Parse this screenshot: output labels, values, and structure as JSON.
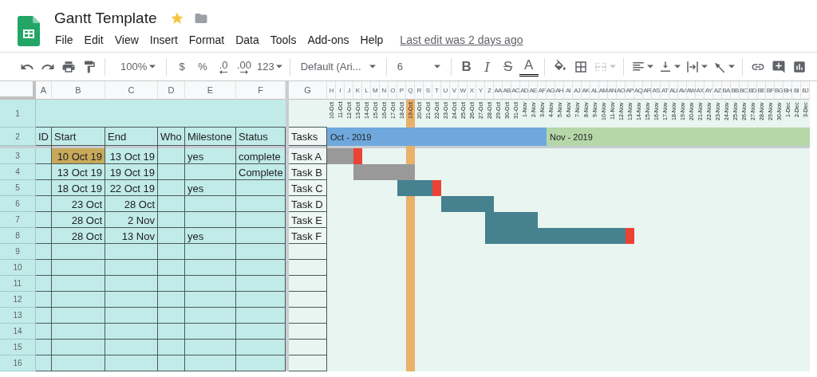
{
  "app": {
    "title": "Gantt Template",
    "menu": [
      "File",
      "Edit",
      "View",
      "Insert",
      "Format",
      "Data",
      "Tools",
      "Add-ons",
      "Help"
    ],
    "last_edit": "Last edit was 2 days ago"
  },
  "toolbar": {
    "groups": [
      {
        "items": [
          {
            "kind": "undo",
            "disabled": false
          },
          {
            "kind": "redo",
            "disabled": false
          },
          {
            "kind": "print",
            "disabled": false
          },
          {
            "kind": "paint",
            "disabled": false
          }
        ]
      },
      {
        "items": [
          {
            "kind": "zoom-select",
            "label": "100%",
            "disabled": false
          }
        ]
      },
      {
        "items": [
          {
            "kind": "text",
            "label": "$",
            "disabled": false
          },
          {
            "kind": "text",
            "label": "%",
            "disabled": false
          },
          {
            "kind": "decimal-less",
            "label": ".0",
            "disabled": false
          },
          {
            "kind": "decimal-more",
            "label": ".00",
            "disabled": false
          },
          {
            "kind": "format-menu",
            "label": "123",
            "disabled": false
          }
        ]
      },
      {
        "items": [
          {
            "kind": "font-select",
            "label": "Default (Ari...",
            "disabled": false
          }
        ]
      },
      {
        "items": [
          {
            "kind": "size-select",
            "label": "6",
            "disabled": false
          }
        ]
      },
      {
        "items": [
          {
            "kind": "bold",
            "label": "B",
            "disabled": false
          },
          {
            "kind": "italic",
            "label": "I",
            "disabled": false
          },
          {
            "kind": "strike",
            "label": "S",
            "disabled": false
          },
          {
            "kind": "text-color",
            "label": "A",
            "disabled": false
          }
        ]
      },
      {
        "items": [
          {
            "kind": "fill",
            "disabled": false
          },
          {
            "kind": "borders",
            "disabled": false
          },
          {
            "kind": "merge",
            "disabled": true
          }
        ]
      },
      {
        "items": [
          {
            "kind": "align",
            "disabled": false
          },
          {
            "kind": "valign",
            "disabled": false
          },
          {
            "kind": "wrap",
            "disabled": false
          },
          {
            "kind": "rotate",
            "disabled": false
          }
        ]
      },
      {
        "items": [
          {
            "kind": "link",
            "disabled": false
          },
          {
            "kind": "comment",
            "disabled": false
          },
          {
            "kind": "chart",
            "disabled": false
          }
        ]
      }
    ]
  },
  "sheet": {
    "columns": [
      "A",
      "B",
      "C",
      "D",
      "E",
      "F"
    ],
    "task_column": "G",
    "row_numbers": [
      "1",
      "2",
      "3",
      "4",
      "5",
      "6",
      "7",
      "8",
      "9",
      "10",
      "11",
      "12",
      "13",
      "14",
      "15",
      "16"
    ],
    "headers": [
      "ID",
      "Start",
      "End",
      "Who",
      "Milestone",
      "Status"
    ],
    "task_header": "Tasks",
    "rows": [
      {
        "start": "10 Oct 19",
        "start_highlighted": true,
        "end": "13 Oct 19",
        "milestone": "yes",
        "status": "complete",
        "task": "Task A",
        "cells": [
          {
            "kind": "done"
          },
          {
            "kind": "done"
          },
          {
            "kind": "done"
          },
          {
            "kind": "milestone"
          },
          {
            "kind": "none"
          },
          {
            "kind": "none"
          },
          {
            "kind": "none"
          },
          {
            "kind": "none"
          },
          {
            "kind": "none"
          },
          {
            "kind": "none"
          },
          {
            "kind": "none"
          },
          {
            "kind": "none"
          },
          {
            "kind": "none"
          },
          {
            "kind": "none"
          },
          {
            "kind": "none"
          },
          {
            "kind": "none"
          },
          {
            "kind": "none"
          },
          {
            "kind": "none"
          },
          {
            "kind": "none"
          },
          {
            "kind": "none"
          },
          {
            "kind": "none"
          },
          {
            "kind": "none"
          },
          {
            "kind": "none"
          },
          {
            "kind": "none"
          },
          {
            "kind": "none"
          },
          {
            "kind": "none"
          },
          {
            "kind": "none"
          },
          {
            "kind": "none"
          },
          {
            "kind": "none"
          },
          {
            "kind": "none"
          },
          {
            "kind": "none"
          },
          {
            "kind": "none"
          },
          {
            "kind": "none"
          },
          {
            "kind": "none"
          },
          {
            "kind": "none"
          },
          {
            "kind": "none"
          },
          {
            "kind": "none"
          },
          {
            "kind": "none"
          },
          {
            "kind": "none"
          },
          {
            "kind": "none"
          },
          {
            "kind": "none"
          },
          {
            "kind": "none"
          },
          {
            "kind": "none"
          },
          {
            "kind": "none"
          },
          {
            "kind": "none"
          },
          {
            "kind": "none"
          },
          {
            "kind": "none"
          },
          {
            "kind": "none"
          },
          {
            "kind": "none"
          },
          {
            "kind": "none"
          },
          {
            "kind": "none"
          },
          {
            "kind": "none"
          },
          {
            "kind": "none"
          },
          {
            "kind": "none"
          },
          {
            "kind": "none"
          }
        ]
      },
      {
        "start": "13 Oct 19",
        "start_highlighted": false,
        "end": "19 Oct 19",
        "status": "Complete",
        "task": "Task B",
        "cells": [
          {
            "kind": "none"
          },
          {
            "kind": "none"
          },
          {
            "kind": "none"
          },
          {
            "kind": "done"
          },
          {
            "kind": "done"
          },
          {
            "kind": "done"
          },
          {
            "kind": "done"
          },
          {
            "kind": "done"
          },
          {
            "kind": "done"
          },
          {
            "kind": "done"
          },
          {
            "kind": "none"
          },
          {
            "kind": "none"
          },
          {
            "kind": "none"
          },
          {
            "kind": "none"
          },
          {
            "kind": "none"
          },
          {
            "kind": "none"
          },
          {
            "kind": "none"
          },
          {
            "kind": "none"
          },
          {
            "kind": "none"
          },
          {
            "kind": "none"
          },
          {
            "kind": "none"
          },
          {
            "kind": "none"
          },
          {
            "kind": "none"
          },
          {
            "kind": "none"
          },
          {
            "kind": "none"
          },
          {
            "kind": "none"
          },
          {
            "kind": "none"
          },
          {
            "kind": "none"
          },
          {
            "kind": "none"
          },
          {
            "kind": "none"
          },
          {
            "kind": "none"
          },
          {
            "kind": "none"
          },
          {
            "kind": "none"
          },
          {
            "kind": "none"
          },
          {
            "kind": "none"
          },
          {
            "kind": "none"
          },
          {
            "kind": "none"
          },
          {
            "kind": "none"
          },
          {
            "kind": "none"
          },
          {
            "kind": "none"
          },
          {
            "kind": "none"
          },
          {
            "kind": "none"
          },
          {
            "kind": "none"
          },
          {
            "kind": "none"
          },
          {
            "kind": "none"
          },
          {
            "kind": "none"
          },
          {
            "kind": "none"
          },
          {
            "kind": "none"
          },
          {
            "kind": "none"
          },
          {
            "kind": "none"
          },
          {
            "kind": "none"
          },
          {
            "kind": "none"
          },
          {
            "kind": "none"
          },
          {
            "kind": "none"
          },
          {
            "kind": "none"
          }
        ]
      },
      {
        "start": "18 Oct 19",
        "start_highlighted": false,
        "end": "22 Oct 19",
        "milestone": "yes",
        "task": "Task C",
        "cells": [
          {
            "kind": "none"
          },
          {
            "kind": "none"
          },
          {
            "kind": "none"
          },
          {
            "kind": "none"
          },
          {
            "kind": "none"
          },
          {
            "kind": "none"
          },
          {
            "kind": "none"
          },
          {
            "kind": "none"
          },
          {
            "kind": "active"
          },
          {
            "kind": "active"
          },
          {
            "kind": "active"
          },
          {
            "kind": "active"
          },
          {
            "kind": "milestone"
          },
          {
            "kind": "none"
          },
          {
            "kind": "none"
          },
          {
            "kind": "none"
          },
          {
            "kind": "none"
          },
          {
            "kind": "none"
          },
          {
            "kind": "none"
          },
          {
            "kind": "none"
          },
          {
            "kind": "none"
          },
          {
            "kind": "none"
          },
          {
            "kind": "none"
          },
          {
            "kind": "none"
          },
          {
            "kind": "none"
          },
          {
            "kind": "none"
          },
          {
            "kind": "none"
          },
          {
            "kind": "none"
          },
          {
            "kind": "none"
          },
          {
            "kind": "none"
          },
          {
            "kind": "none"
          },
          {
            "kind": "none"
          },
          {
            "kind": "none"
          },
          {
            "kind": "none"
          },
          {
            "kind": "none"
          },
          {
            "kind": "none"
          },
          {
            "kind": "none"
          },
          {
            "kind": "none"
          },
          {
            "kind": "none"
          },
          {
            "kind": "none"
          },
          {
            "kind": "none"
          },
          {
            "kind": "none"
          },
          {
            "kind": "none"
          },
          {
            "kind": "none"
          },
          {
            "kind": "none"
          },
          {
            "kind": "none"
          },
          {
            "kind": "none"
          },
          {
            "kind": "none"
          },
          {
            "kind": "none"
          },
          {
            "kind": "none"
          },
          {
            "kind": "none"
          },
          {
            "kind": "none"
          },
          {
            "kind": "none"
          },
          {
            "kind": "none"
          },
          {
            "kind": "none"
          }
        ]
      },
      {
        "start": "23 Oct",
        "start_highlighted": false,
        "end": "28 Oct",
        "task": "Task D",
        "cells": [
          {
            "kind": "none"
          },
          {
            "kind": "none"
          },
          {
            "kind": "none"
          },
          {
            "kind": "none"
          },
          {
            "kind": "none"
          },
          {
            "kind": "none"
          },
          {
            "kind": "none"
          },
          {
            "kind": "none"
          },
          {
            "kind": "none"
          },
          {
            "kind": "none"
          },
          {
            "kind": "none"
          },
          {
            "kind": "none"
          },
          {
            "kind": "none"
          },
          {
            "kind": "active"
          },
          {
            "kind": "active"
          },
          {
            "kind": "active"
          },
          {
            "kind": "active"
          },
          {
            "kind": "active"
          },
          {
            "kind": "active"
          },
          {
            "kind": "none"
          },
          {
            "kind": "none"
          },
          {
            "kind": "none"
          },
          {
            "kind": "none"
          },
          {
            "kind": "none"
          },
          {
            "kind": "none"
          },
          {
            "kind": "none"
          },
          {
            "kind": "none"
          },
          {
            "kind": "none"
          },
          {
            "kind": "none"
          },
          {
            "kind": "none"
          },
          {
            "kind": "none"
          },
          {
            "kind": "none"
          },
          {
            "kind": "none"
          },
          {
            "kind": "none"
          },
          {
            "kind": "none"
          },
          {
            "kind": "none"
          },
          {
            "kind": "none"
          },
          {
            "kind": "none"
          },
          {
            "kind": "none"
          },
          {
            "kind": "none"
          },
          {
            "kind": "none"
          },
          {
            "kind": "none"
          },
          {
            "kind": "none"
          },
          {
            "kind": "none"
          },
          {
            "kind": "none"
          },
          {
            "kind": "none"
          },
          {
            "kind": "none"
          },
          {
            "kind": "none"
          },
          {
            "kind": "none"
          },
          {
            "kind": "none"
          },
          {
            "kind": "none"
          },
          {
            "kind": "none"
          },
          {
            "kind": "none"
          },
          {
            "kind": "none"
          },
          {
            "kind": "none"
          }
        ]
      },
      {
        "start": "28 Oct",
        "start_highlighted": false,
        "end": "2 Nov",
        "task": "Task E",
        "cells": [
          {
            "kind": "none"
          },
          {
            "kind": "none"
          },
          {
            "kind": "none"
          },
          {
            "kind": "none"
          },
          {
            "kind": "none"
          },
          {
            "kind": "none"
          },
          {
            "kind": "none"
          },
          {
            "kind": "none"
          },
          {
            "kind": "none"
          },
          {
            "kind": "none"
          },
          {
            "kind": "none"
          },
          {
            "kind": "none"
          },
          {
            "kind": "none"
          },
          {
            "kind": "none"
          },
          {
            "kind": "none"
          },
          {
            "kind": "none"
          },
          {
            "kind": "none"
          },
          {
            "kind": "none"
          },
          {
            "kind": "active"
          },
          {
            "kind": "active"
          },
          {
            "kind": "active"
          },
          {
            "kind": "active"
          },
          {
            "kind": "active"
          },
          {
            "kind": "active"
          },
          {
            "kind": "none"
          },
          {
            "kind": "none"
          },
          {
            "kind": "none"
          },
          {
            "kind": "none"
          },
          {
            "kind": "none"
          },
          {
            "kind": "none"
          },
          {
            "kind": "none"
          },
          {
            "kind": "none"
          },
          {
            "kind": "none"
          },
          {
            "kind": "none"
          },
          {
            "kind": "none"
          },
          {
            "kind": "none"
          },
          {
            "kind": "none"
          },
          {
            "kind": "none"
          },
          {
            "kind": "none"
          },
          {
            "kind": "none"
          },
          {
            "kind": "none"
          },
          {
            "kind": "none"
          },
          {
            "kind": "none"
          },
          {
            "kind": "none"
          },
          {
            "kind": "none"
          },
          {
            "kind": "none"
          },
          {
            "kind": "none"
          },
          {
            "kind": "none"
          },
          {
            "kind": "none"
          },
          {
            "kind": "none"
          },
          {
            "kind": "none"
          },
          {
            "kind": "none"
          },
          {
            "kind": "none"
          },
          {
            "kind": "none"
          },
          {
            "kind": "none"
          }
        ]
      },
      {
        "start": "28 Oct",
        "start_highlighted": false,
        "end": "13 Nov",
        "milestone": "yes",
        "task": "Task F",
        "cells": [
          {
            "kind": "none"
          },
          {
            "kind": "none"
          },
          {
            "kind": "none"
          },
          {
            "kind": "none"
          },
          {
            "kind": "none"
          },
          {
            "kind": "none"
          },
          {
            "kind": "none"
          },
          {
            "kind": "none"
          },
          {
            "kind": "none"
          },
          {
            "kind": "none"
          },
          {
            "kind": "none"
          },
          {
            "kind": "none"
          },
          {
            "kind": "none"
          },
          {
            "kind": "none"
          },
          {
            "kind": "none"
          },
          {
            "kind": "none"
          },
          {
            "kind": "none"
          },
          {
            "kind": "none"
          },
          {
            "kind": "active"
          },
          {
            "kind": "active"
          },
          {
            "kind": "active"
          },
          {
            "kind": "active"
          },
          {
            "kind": "active"
          },
          {
            "kind": "active"
          },
          {
            "kind": "active"
          },
          {
            "kind": "active"
          },
          {
            "kind": "active"
          },
          {
            "kind": "active"
          },
          {
            "kind": "active"
          },
          {
            "kind": "active"
          },
          {
            "kind": "active"
          },
          {
            "kind": "active"
          },
          {
            "kind": "active"
          },
          {
            "kind": "active"
          },
          {
            "kind": "milestone"
          },
          {
            "kind": "none"
          },
          {
            "kind": "none"
          },
          {
            "kind": "none"
          },
          {
            "kind": "none"
          },
          {
            "kind": "none"
          },
          {
            "kind": "none"
          },
          {
            "kind": "none"
          },
          {
            "kind": "none"
          },
          {
            "kind": "none"
          },
          {
            "kind": "none"
          },
          {
            "kind": "none"
          },
          {
            "kind": "none"
          },
          {
            "kind": "none"
          },
          {
            "kind": "none"
          },
          {
            "kind": "none"
          },
          {
            "kind": "none"
          },
          {
            "kind": "none"
          },
          {
            "kind": "none"
          },
          {
            "kind": "none"
          },
          {
            "kind": "none"
          }
        ]
      }
    ]
  },
  "timeline": {
    "months": [
      {
        "label": "Oct - 2019",
        "color": "#6fa8dc",
        "days": [
          {
            "col": "H",
            "date": "10-Oct",
            "today": false
          },
          {
            "col": "I",
            "date": "11-Oct",
            "today": false
          },
          {
            "col": "J",
            "date": "12-Oct",
            "today": false
          },
          {
            "col": "K",
            "date": "13-Oct",
            "today": false
          },
          {
            "col": "L",
            "date": "14-Oct",
            "today": false
          },
          {
            "col": "M",
            "date": "15-Oct",
            "today": false
          },
          {
            "col": "N",
            "date": "16-Oct",
            "today": false
          },
          {
            "col": "O",
            "date": "17-Oct",
            "today": false
          },
          {
            "col": "P",
            "date": "18-Oct",
            "today": false
          },
          {
            "col": "Q",
            "date": "19-Oct",
            "today": true
          },
          {
            "col": "R",
            "date": "20-Oct",
            "today": false
          },
          {
            "col": "S",
            "date": "21-Oct",
            "today": false
          },
          {
            "col": "T",
            "date": "22-Oct",
            "today": false
          },
          {
            "col": "U",
            "date": "23-Oct",
            "today": false
          },
          {
            "col": "V",
            "date": "24-Oct",
            "today": false
          },
          {
            "col": "W",
            "date": "25-Oct",
            "today": false
          },
          {
            "col": "X",
            "date": "26-Oct",
            "today": false
          },
          {
            "col": "Y",
            "date": "27-Oct",
            "today": false
          },
          {
            "col": "Z",
            "date": "28-Oct",
            "today": false
          },
          {
            "col": "AA",
            "date": "29-Oct",
            "today": false
          },
          {
            "col": "AB",
            "date": "30-Oct",
            "today": false
          },
          {
            "col": "AC",
            "date": "31-Oct",
            "today": false
          },
          {
            "col": "AD",
            "date": "1-Nov",
            "today": false
          },
          {
            "col": "AE",
            "date": "2-Nov",
            "today": false
          },
          {
            "col": "AF",
            "date": "3-Nov",
            "today": false
          }
        ]
      },
      {
        "label": "Nov - 2019",
        "color": "#b6d7a8",
        "days": [
          {
            "col": "AG",
            "date": "4-Nov",
            "today": false
          },
          {
            "col": "AH",
            "date": "5-Nov",
            "today": false
          },
          {
            "col": "AI",
            "date": "6-Nov",
            "today": false
          },
          {
            "col": "AJ",
            "date": "7-Nov",
            "today": false
          },
          {
            "col": "AK",
            "date": "8-Nov",
            "today": false
          },
          {
            "col": "AL",
            "date": "9-Nov",
            "today": false
          },
          {
            "col": "AM",
            "date": "10-Nov",
            "today": false
          },
          {
            "col": "AN",
            "date": "11-Nov",
            "today": false
          },
          {
            "col": "AO",
            "date": "12-Nov",
            "today": false
          },
          {
            "col": "AP",
            "date": "13-Nov",
            "today": false
          },
          {
            "col": "AQ",
            "date": "14-Nov",
            "today": false
          },
          {
            "col": "AR",
            "date": "15-Nov",
            "today": false
          },
          {
            "col": "AS",
            "date": "16-Nov",
            "today": false
          },
          {
            "col": "AT",
            "date": "17-Nov",
            "today": false
          },
          {
            "col": "AU",
            "date": "18-Nov",
            "today": false
          },
          {
            "col": "AV",
            "date": "19-Nov",
            "today": false
          },
          {
            "col": "AW",
            "date": "20-Nov",
            "today": false
          },
          {
            "col": "AX",
            "date": "21-Nov",
            "today": false
          },
          {
            "col": "AY",
            "date": "22-Nov",
            "today": false
          },
          {
            "col": "AZ",
            "date": "23-Nov",
            "today": false
          },
          {
            "col": "BA",
            "date": "24-Nov",
            "today": false
          },
          {
            "col": "BB",
            "date": "25-Nov",
            "today": false
          },
          {
            "col": "BC",
            "date": "26-Nov",
            "today": false
          },
          {
            "col": "BD",
            "date": "27-Nov",
            "today": false
          },
          {
            "col": "BE",
            "date": "28-Nov",
            "today": false
          },
          {
            "col": "BF",
            "date": "29-Nov",
            "today": false
          },
          {
            "col": "BG",
            "date": "30-Nov",
            "today": false
          },
          {
            "col": "BH",
            "date": "1-Dec",
            "today": false
          },
          {
            "col": "BI",
            "date": "2-Dec",
            "today": false
          },
          {
            "col": "BJ",
            "date": "3-Dec",
            "today": false
          }
        ]
      }
    ]
  }
}
